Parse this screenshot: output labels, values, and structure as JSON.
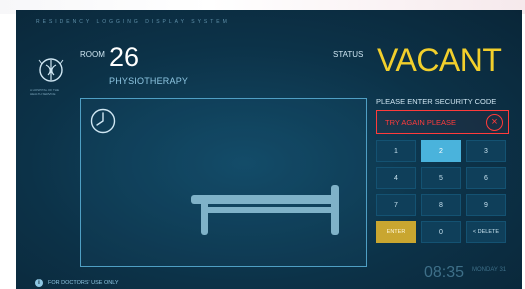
{
  "header": {
    "system_title": "RESIDENCY LOGGING DISPLAY SYSTEM"
  },
  "logo": {
    "caption": "A HOSPITAL OF THE HEALTH SERVICE"
  },
  "room": {
    "label": "ROOM",
    "number": "26",
    "name": "PHYSIOTHERAPY"
  },
  "status": {
    "label": "STATUS",
    "value": "VACANT"
  },
  "security": {
    "prompt": "PLEASE ENTER SECURITY CODE",
    "error_message": "TRY AGAIN PLEASE",
    "clear_icon": "close-circle-icon"
  },
  "keypad": {
    "keys": [
      "1",
      "2",
      "3",
      "4",
      "5",
      "6",
      "7",
      "8",
      "9",
      "ENTER",
      "0",
      "< DELETE"
    ],
    "active_key": "2"
  },
  "clock": {
    "time": "08:35",
    "day": "MONDAY 31"
  },
  "footer": {
    "icon": "info-icon",
    "note": "FOR DOCTORS' USE ONLY"
  },
  "colors": {
    "status_accent": "#f2cf2c",
    "error": "#ff3b3b",
    "active_key": "#4ab3dc",
    "enter_key": "#c9a630"
  }
}
